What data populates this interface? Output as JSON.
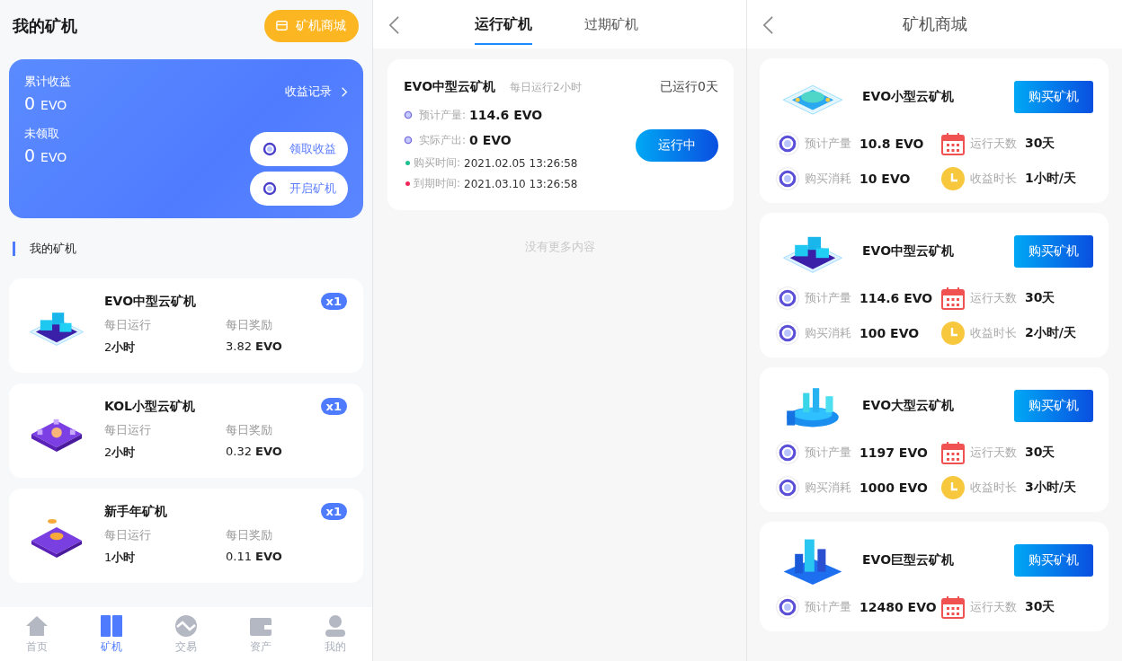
{
  "my_miners": {
    "title": "我的矿机",
    "shop_button": "矿机商城",
    "summary": {
      "total_label": "累计收益",
      "total_value": "0",
      "total_unit": "EVO",
      "unclaimed_label": "未领取",
      "unclaimed_value": "0",
      "unclaimed_unit": "EVO",
      "record_link": "收益记录",
      "buttons": [
        "领取收益",
        "开启矿机"
      ]
    },
    "section_title": "我的矿机",
    "machines": [
      {
        "kind": "servers",
        "name": "EVO中型云矿机",
        "count": "x1",
        "run_label": "每日运行",
        "run_value": "2**小时**",
        "reward_label": "每日奖励",
        "reward_value": "3.82 **EVO**"
      },
      {
        "kind": "purple-platform",
        "name": "KOL小型云矿机",
        "count": "x1",
        "run_label": "每日运行",
        "run_value": "2**小时**",
        "reward_label": "每日奖励",
        "reward_value": "0.32 **EVO**"
      },
      {
        "kind": "purple-coin",
        "name": "新手年矿机",
        "count": "x1",
        "run_label": "每日运行",
        "run_value": "1**小时**",
        "reward_label": "每日奖励",
        "reward_value": "0.11 **EVO**"
      }
    ],
    "nav": [
      {
        "kind": "home",
        "label": "首页",
        "selected": false
      },
      {
        "kind": "miner",
        "label": "矿机",
        "selected": true
      },
      {
        "kind": "trade",
        "label": "交易",
        "selected": false
      },
      {
        "kind": "wallet",
        "label": "资产",
        "selected": false
      },
      {
        "kind": "user",
        "label": "我的",
        "selected": false
      }
    ]
  },
  "running": {
    "tabs": [
      {
        "label": "运行矿机",
        "selected": true
      },
      {
        "label": "过期矿机",
        "selected": false
      }
    ],
    "order": {
      "name": "EVO中型云矿机",
      "subtitle": "每日运行2小时",
      "days": "已运行0天",
      "status_button": "运行中",
      "rows": [
        {
          "kind": "coin",
          "label": "预计产量:",
          "value": "114.6 EVO"
        },
        {
          "kind": "coin",
          "label": "实际产出:",
          "value": "0 EVO"
        },
        {
          "kind": "dot",
          "color": "#1fbf8f",
          "label": "购买时间:",
          "value": "2021.02.05 13:26:58"
        },
        {
          "kind": "dot",
          "color": "#f0285a",
          "label": "到期时间:",
          "value": "2021.03.10 13:26:58"
        }
      ]
    },
    "footer": "没有更多内容"
  },
  "shop": {
    "title": "矿机商城",
    "products": [
      {
        "kind": "chip",
        "name": "EVO小型云矿机",
        "button": "购买矿机",
        "stats": [
          [
            {
              "kind": "coin",
              "label": "预计产量",
              "value": "10.8 EVO"
            },
            {
              "kind": "calendar",
              "label": "运行天数",
              "value": "30天"
            }
          ],
          [
            {
              "kind": "coin",
              "label": "购买消耗",
              "value": "10 EVO"
            },
            {
              "kind": "clock",
              "label": "收益时长",
              "value": "1小时/天"
            }
          ]
        ]
      },
      {
        "kind": "servers",
        "name": "EVO中型云矿机",
        "button": "购买矿机",
        "stats": [
          [
            {
              "kind": "coin",
              "label": "预计产量",
              "value": "114.6 EVO"
            },
            {
              "kind": "calendar",
              "label": "运行天数",
              "value": "30天"
            }
          ],
          [
            {
              "kind": "coin",
              "label": "购买消耗",
              "value": "100 EVO"
            },
            {
              "kind": "clock",
              "label": "收益时长",
              "value": "2小时/天"
            }
          ]
        ]
      },
      {
        "kind": "ring",
        "name": "EVO大型云矿机",
        "button": "购买矿机",
        "stats": [
          [
            {
              "kind": "coin",
              "label": "预计产量",
              "value": "1197 EVO"
            },
            {
              "kind": "calendar",
              "label": "运行天数",
              "value": "30天"
            }
          ],
          [
            {
              "kind": "coin",
              "label": "购买消耗",
              "value": "1000 EVO"
            },
            {
              "kind": "clock",
              "label": "收益时长",
              "value": "3小时/天"
            }
          ]
        ]
      },
      {
        "kind": "city",
        "name": "EVO巨型云矿机",
        "button": "购买矿机",
        "stats": [
          [
            {
              "kind": "coin",
              "label": "预计产量",
              "value": "12480 EVO"
            },
            {
              "kind": "calendar",
              "label": "运行天数",
              "value": "30天"
            }
          ]
        ]
      }
    ]
  }
}
